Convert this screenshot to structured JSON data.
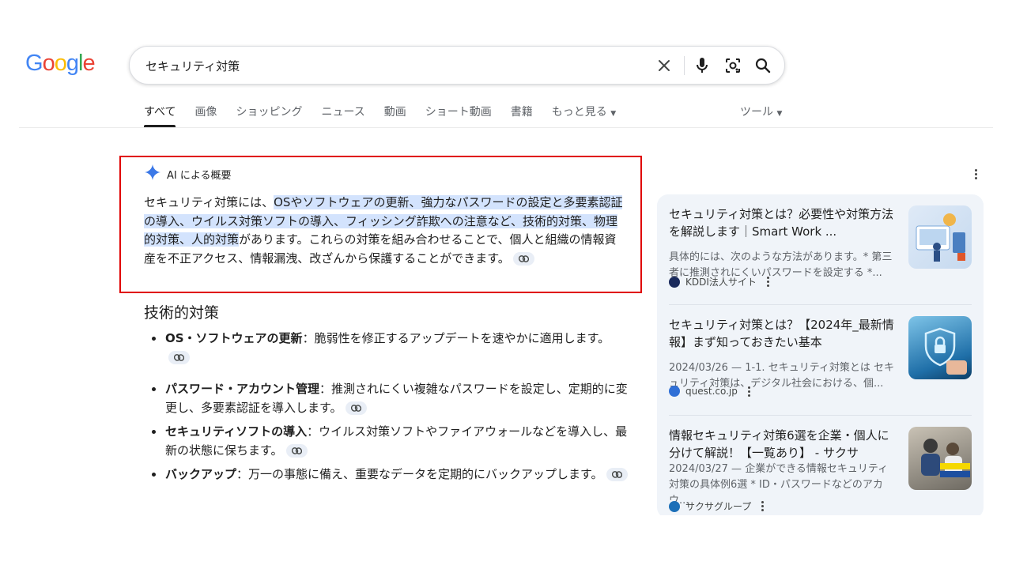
{
  "logo": {
    "letters": [
      "G",
      "o",
      "o",
      "g",
      "l",
      "e"
    ],
    "colors": [
      "#4285F4",
      "#EA4335",
      "#FBBC05",
      "#4285F4",
      "#34A853",
      "#EA4335"
    ]
  },
  "search": {
    "query": "セキュリティ対策",
    "icons": [
      "close-icon",
      "mic-icon",
      "lens-icon",
      "search-icon"
    ]
  },
  "tabs": [
    "すべて",
    "画像",
    "ショッピング",
    "ニュース",
    "動画",
    "ショート動画",
    "書籍",
    "もっと見る"
  ],
  "tools_label": "ツール",
  "ai_overview": {
    "label": "AI による概要",
    "summary": {
      "part1": "セキュリティ対策には、",
      "highlight": "OSやソフトウェアの更新、強力なパスワードの設定と多要素認証の導入、ウイルス対策ソフトの導入、フィッシング詐欺への注意など、技術的対策、物理的対策、人的対策",
      "part2": "があります。これらの対策を組み合わせることで、個人と組織の情報資産を不正アクセス、情報漏洩、改ざんから保護することができます。"
    },
    "section_title": "技術的対策",
    "bullets": [
      {
        "term": "OS・ソフトウェアの更新",
        "text": "：脆弱性を修正するアップデートを速やかに適用します。"
      },
      {
        "term": "パスワード・アカウント管理",
        "text": "：推測されにくい複雑なパスワードを設定し、定期的に変更し、多要素認証を導入します。"
      },
      {
        "term": "セキュリティソフトの導入",
        "text": "：ウイルス対策ソフトやファイアウォールなどを導入し、最新の状態に保ちます。"
      },
      {
        "term": "バックアップ",
        "text": "：万一の事態に備え、重要なデータを定期的にバックアップします。"
      }
    ]
  },
  "sources": [
    {
      "title": "セキュリティ対策とは？必要性や対策方法を解説します｜Smart Work ...",
      "snippet": "具体的には、次のような方法があります。* 第三者に推測されにくいパスワードを設定する *...",
      "site": "KDDI法人サイト",
      "favicon_color": "#1a2a5c"
    },
    {
      "title": "セキュリティ対策とは？【2024年_最新情報】まず知っておきたい基本",
      "snippet": "2024/03/26 — 1-1. セキュリティ対策とは セキュリティ対策は、デジタル社会における、個...",
      "site": "quest.co.jp",
      "favicon_color": "#2f6fd6"
    },
    {
      "title": "情報セキュリティ対策6選を企業・個人に分けて解説！【一覧あり】 - サクサ",
      "snippet": "2024/03/27 — 企業ができる情報セキュリティ対策の具体例6選 * ID・パスワードなどのアカウ...",
      "site": "サクサグループ",
      "favicon_color": "#1c6fb8"
    }
  ],
  "colors": {
    "highlight": "#d3e3fd",
    "annotation_box": "#e00000",
    "panel_bg": "#f0f4f9"
  }
}
